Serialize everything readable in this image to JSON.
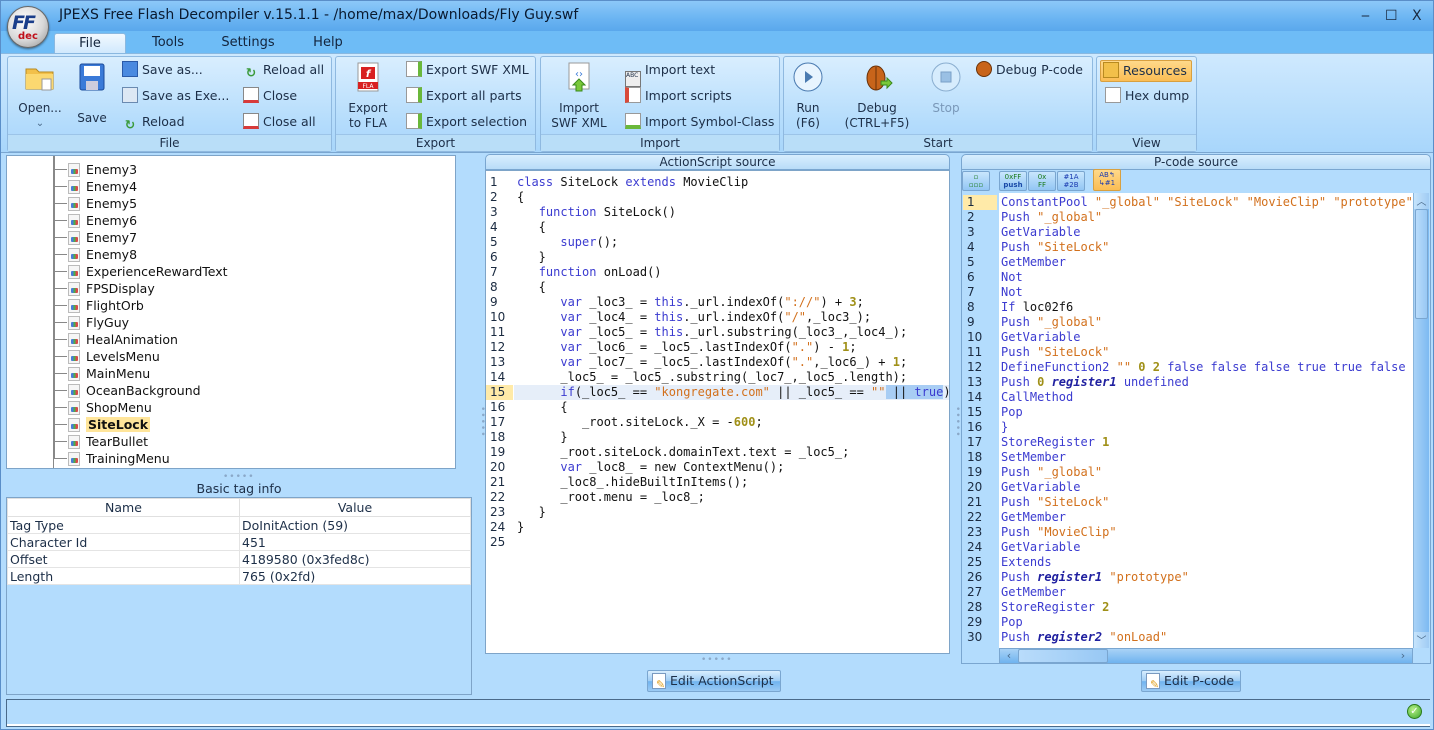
{
  "window": {
    "title": "JPEXS Free Flash Decompiler v.15.1.1 - /home/max/Downloads/Fly Guy.swf",
    "logo_top": "FF",
    "logo_bottom": "dec",
    "controls": {
      "minimize": "‒",
      "maximize": "☐",
      "close": "X"
    }
  },
  "menu_tabs": [
    {
      "label": "File",
      "active": true
    },
    {
      "label": "Tools"
    },
    {
      "label": "Settings"
    },
    {
      "label": "Help"
    }
  ],
  "ribbon": {
    "file": {
      "label": "File",
      "open": "Open...",
      "save": "Save",
      "save_as": "Save as...",
      "save_as_exe": "Save as Exe...",
      "reload": "Reload",
      "reload_all": "Reload all",
      "close": "Close",
      "close_all": "Close all"
    },
    "export": {
      "label": "Export",
      "export_fla_line1": "Export",
      "export_fla_line2": "to FLA",
      "export_swf_xml": "Export SWF XML",
      "export_all_parts": "Export all parts",
      "export_selection": "Export selection"
    },
    "import": {
      "label": "Import",
      "import_swf_xml_line1": "Import",
      "import_swf_xml_line2": "SWF XML",
      "import_text": "Import text",
      "import_scripts": "Import scripts",
      "import_symbol_class": "Import Symbol-Class"
    },
    "start": {
      "label": "Start",
      "run_line1": "Run",
      "run_line2": "(F6)",
      "debug_line1": "Debug",
      "debug_line2": "(CTRL+F5)",
      "stop": "Stop",
      "debug_pcode": "Debug P-code"
    },
    "view": {
      "label": "View",
      "resources": "Resources",
      "hex_dump": "Hex dump"
    }
  },
  "tree": {
    "items": [
      "Enemy3",
      "Enemy4",
      "Enemy5",
      "Enemy6",
      "Enemy7",
      "Enemy8",
      "ExperienceRewardText",
      "FPSDisplay",
      "FlightOrb",
      "FlyGuy",
      "HealAnimation",
      "LevelsMenu",
      "MainMenu",
      "OceanBackground",
      "ShopMenu",
      "SiteLock",
      "TearBullet",
      "TrainingMenu"
    ],
    "selected": "SiteLock"
  },
  "tag_info": {
    "title": "Basic tag info",
    "columns": [
      "Name",
      "Value"
    ],
    "rows": [
      [
        "Tag Type",
        "DoInitAction (59)"
      ],
      [
        "Character Id",
        "451"
      ],
      [
        "Offset",
        "4189580 (0x3fed8c)"
      ],
      [
        "Length",
        "765 (0x2fd)"
      ]
    ]
  },
  "actionscript": {
    "title": "ActionScript source",
    "current_line": 15,
    "lines": [
      [
        [
          "kw",
          "class "
        ],
        [
          "plain",
          "SiteLock "
        ],
        [
          "kw",
          "extends "
        ],
        [
          "plain",
          "MovieClip"
        ]
      ],
      [
        [
          "plain",
          "{"
        ]
      ],
      [
        [
          "plain",
          "   "
        ],
        [
          "kw",
          "function "
        ],
        [
          "plain",
          "SiteLock()"
        ]
      ],
      [
        [
          "plain",
          "   {"
        ]
      ],
      [
        [
          "plain",
          "      "
        ],
        [
          "kw",
          "super"
        ],
        [
          "plain",
          "();"
        ]
      ],
      [
        [
          "plain",
          "   }"
        ]
      ],
      [
        [
          "plain",
          "   "
        ],
        [
          "kw",
          "function "
        ],
        [
          "plain",
          "onLoad()"
        ]
      ],
      [
        [
          "plain",
          "   {"
        ]
      ],
      [
        [
          "plain",
          "      "
        ],
        [
          "kw",
          "var "
        ],
        [
          "plain",
          "_loc3_ = "
        ],
        [
          "kw",
          "this"
        ],
        [
          "plain",
          "._url.indexOf("
        ],
        [
          "str",
          "\"://\""
        ],
        [
          "plain",
          ") + "
        ],
        [
          "num",
          "3"
        ],
        [
          "plain",
          ";"
        ]
      ],
      [
        [
          "plain",
          "      "
        ],
        [
          "kw",
          "var "
        ],
        [
          "plain",
          "_loc4_ = "
        ],
        [
          "kw",
          "this"
        ],
        [
          "plain",
          "._url.indexOf("
        ],
        [
          "str",
          "\"/\""
        ],
        [
          "plain",
          ",_loc3_);"
        ]
      ],
      [
        [
          "plain",
          "      "
        ],
        [
          "kw",
          "var "
        ],
        [
          "plain",
          "_loc5_ = "
        ],
        [
          "kw",
          "this"
        ],
        [
          "plain",
          "._url.substring(_loc3_,_loc4_);"
        ]
      ],
      [
        [
          "plain",
          "      "
        ],
        [
          "kw",
          "var "
        ],
        [
          "plain",
          "_loc6_ = _loc5_.lastIndexOf("
        ],
        [
          "str",
          "\".\""
        ],
        [
          "plain",
          ") - "
        ],
        [
          "num",
          "1"
        ],
        [
          "plain",
          ";"
        ]
      ],
      [
        [
          "plain",
          "      "
        ],
        [
          "kw",
          "var "
        ],
        [
          "plain",
          "_loc7_ = _loc5_.lastIndexOf("
        ],
        [
          "str",
          "\".\""
        ],
        [
          "plain",
          ",_loc6_) + "
        ],
        [
          "num",
          "1"
        ],
        [
          "plain",
          ";"
        ]
      ],
      [
        [
          "plain",
          "      _loc5_ = _loc5_.substring(_loc7_,_loc5_.length);"
        ]
      ],
      [
        [
          "plain",
          "      "
        ],
        [
          "kw",
          "if"
        ],
        [
          "plain",
          "(_loc5_ == "
        ],
        [
          "str",
          "\"kongregate.com\""
        ],
        [
          "plain",
          " || _loc5_ == "
        ],
        [
          "str",
          "\"\""
        ],
        [
          "sel",
          " || "
        ],
        [
          "selkw",
          "true"
        ],
        [
          "plain",
          ")"
        ]
      ],
      [
        [
          "plain",
          "      {"
        ]
      ],
      [
        [
          "plain",
          "         _root.siteLock._X = -"
        ],
        [
          "num",
          "600"
        ],
        [
          "plain",
          ";"
        ]
      ],
      [
        [
          "plain",
          "      }"
        ]
      ],
      [
        [
          "plain",
          "      _root.siteLock.domainText.text = _loc5_;"
        ]
      ],
      [
        [
          "plain",
          "      "
        ],
        [
          "kw",
          "var "
        ],
        [
          "plain",
          "_loc8_ = new ContextMenu();"
        ]
      ],
      [
        [
          "plain",
          "      _loc8_.hideBuiltInItems();"
        ]
      ],
      [
        [
          "plain",
          "      _root.menu = _loc8_;"
        ]
      ],
      [
        [
          "plain",
          "   }"
        ]
      ],
      [
        [
          "plain",
          "}"
        ]
      ],
      []
    ],
    "edit_button": "Edit ActionScript"
  },
  "pcode": {
    "title": "P-code source",
    "toolbar": [
      {
        "name": "graph-view-button",
        "glyph": "▫▫▫"
      },
      {
        "name": "hex-push-button",
        "glyph": "0xFF push"
      },
      {
        "name": "hex-values-button",
        "glyph": "0x FF"
      },
      {
        "name": "resolve-constants-button",
        "glyph": "#1A #2B"
      },
      {
        "name": "deobfuscate-button",
        "glyph": "AB #1",
        "active": true
      }
    ],
    "current_line": 1,
    "lines": [
      [
        [
          "kw",
          "ConstantPool "
        ],
        [
          "str",
          "\"_global\" \"SiteLock\" \"MovieClip\" \"prototype\" \""
        ]
      ],
      [
        [
          "kw",
          "Push "
        ],
        [
          "str",
          "\"_global\""
        ]
      ],
      [
        [
          "kw",
          "GetVariable"
        ]
      ],
      [
        [
          "kw",
          "Push "
        ],
        [
          "str",
          "\"SiteLock\""
        ]
      ],
      [
        [
          "kw",
          "GetMember"
        ]
      ],
      [
        [
          "kw",
          "Not"
        ]
      ],
      [
        [
          "kw",
          "Not"
        ]
      ],
      [
        [
          "kw",
          "If "
        ],
        [
          "plain",
          "loc02f6"
        ]
      ],
      [
        [
          "kw",
          "Push "
        ],
        [
          "str",
          "\"_global\""
        ]
      ],
      [
        [
          "kw",
          "GetVariable"
        ]
      ],
      [
        [
          "kw",
          "Push "
        ],
        [
          "str",
          "\"SiteLock\""
        ]
      ],
      [
        [
          "kw",
          "DefineFunction2 "
        ],
        [
          "str",
          "\"\" "
        ],
        [
          "num",
          "0 2 "
        ],
        [
          "kw",
          "false false false true true false tr"
        ]
      ],
      [
        [
          "kw",
          "Push "
        ],
        [
          "num",
          "0 "
        ],
        [
          "reg",
          "register1"
        ],
        [
          "kw",
          " undefined"
        ]
      ],
      [
        [
          "kw",
          "CallMethod"
        ]
      ],
      [
        [
          "kw",
          "Pop"
        ]
      ],
      [
        [
          "kw",
          "}"
        ]
      ],
      [
        [
          "kw",
          "StoreRegister "
        ],
        [
          "num",
          "1"
        ]
      ],
      [
        [
          "kw",
          "SetMember"
        ]
      ],
      [
        [
          "kw",
          "Push "
        ],
        [
          "str",
          "\"_global\""
        ]
      ],
      [
        [
          "kw",
          "GetVariable"
        ]
      ],
      [
        [
          "kw",
          "Push "
        ],
        [
          "str",
          "\"SiteLock\""
        ]
      ],
      [
        [
          "kw",
          "GetMember"
        ]
      ],
      [
        [
          "kw",
          "Push "
        ],
        [
          "str",
          "\"MovieClip\""
        ]
      ],
      [
        [
          "kw",
          "GetVariable"
        ]
      ],
      [
        [
          "kw",
          "Extends"
        ]
      ],
      [
        [
          "kw",
          "Push "
        ],
        [
          "reg",
          "register1"
        ],
        [
          "str",
          " \"prototype\""
        ]
      ],
      [
        [
          "kw",
          "GetMember"
        ]
      ],
      [
        [
          "kw",
          "StoreRegister "
        ],
        [
          "num",
          "2"
        ]
      ],
      [
        [
          "kw",
          "Pop"
        ]
      ],
      [
        [
          "kw",
          "Push "
        ],
        [
          "reg",
          "register2"
        ],
        [
          "str",
          " \"onLoad\""
        ]
      ]
    ],
    "edit_button": "Edit P-code"
  },
  "status": {
    "icon": "ok-check-icon"
  },
  "colors": {
    "accent": "#6ebcf6",
    "panel_bg": "#b3dcfd",
    "keyword": "#3b3bd0",
    "string": "#d2701c",
    "number": "#a09018",
    "selected_item": "#ffe59a"
  }
}
